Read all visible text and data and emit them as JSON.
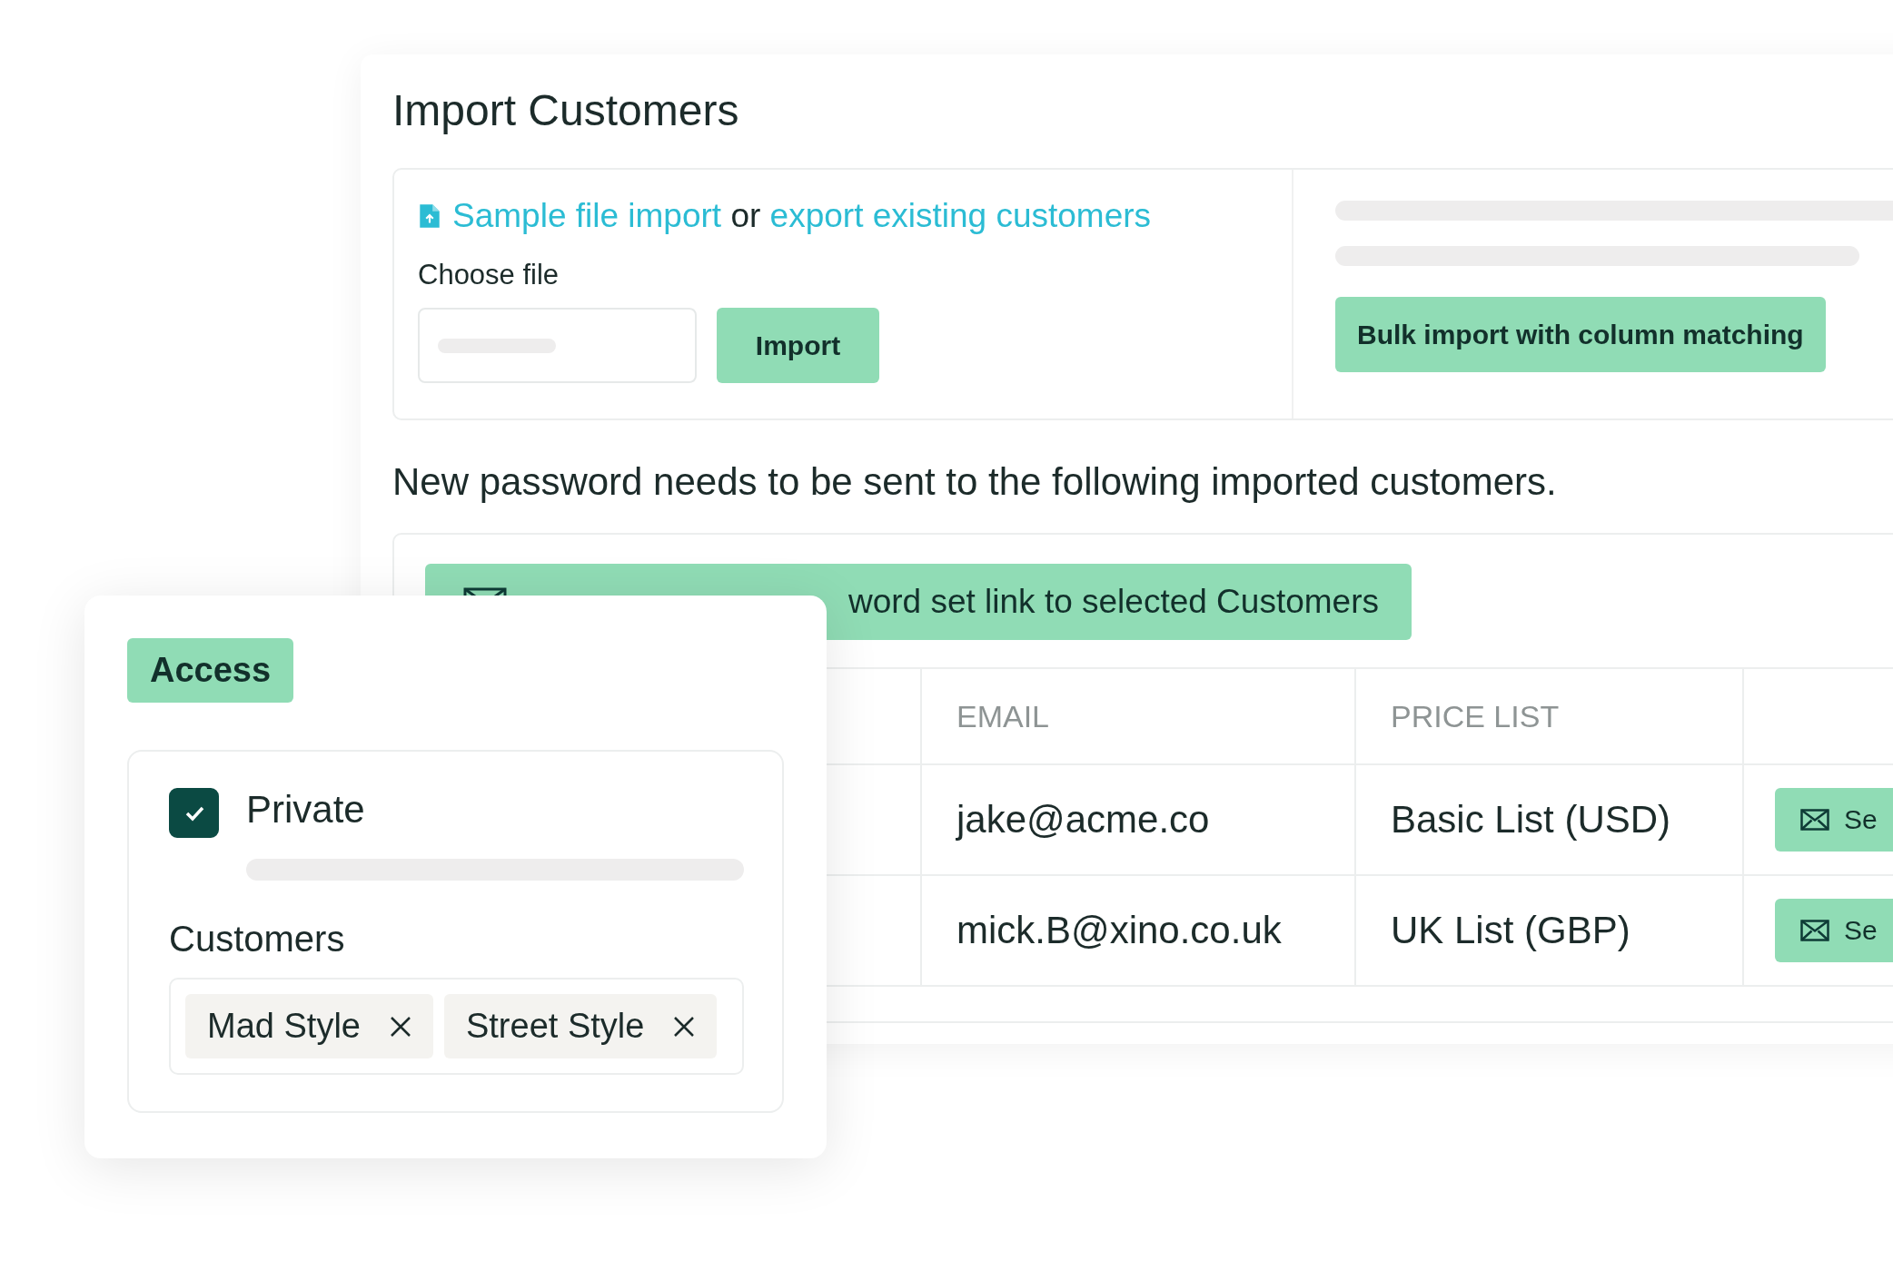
{
  "title": "Import Customers",
  "import_panel": {
    "links": [
      "Sample file import",
      "export existing customers"
    ],
    "connector": "or",
    "choose_file_label": "Choose file",
    "import_button": "Import",
    "bulk_import_button": "Bulk import with column matching"
  },
  "notice": "New password needs to be sent to the following imported customers.",
  "send_selected_button": "word set link to selected Customers",
  "table": {
    "columns": [
      "EMAIL",
      "PRICE LIST"
    ],
    "rows": [
      {
        "email": "jake@acme.co",
        "price_list": "Basic List (USD)",
        "send_button": "Se"
      },
      {
        "email": "mick.B@xino.co.uk",
        "price_list": "UK List (GBP)",
        "send_button": "Se"
      }
    ]
  },
  "access_card": {
    "badge": "Access",
    "private": {
      "label": "Private",
      "checked": true
    },
    "customers_label": "Customers",
    "tags": [
      "Mad Style",
      "Street Style"
    ]
  }
}
